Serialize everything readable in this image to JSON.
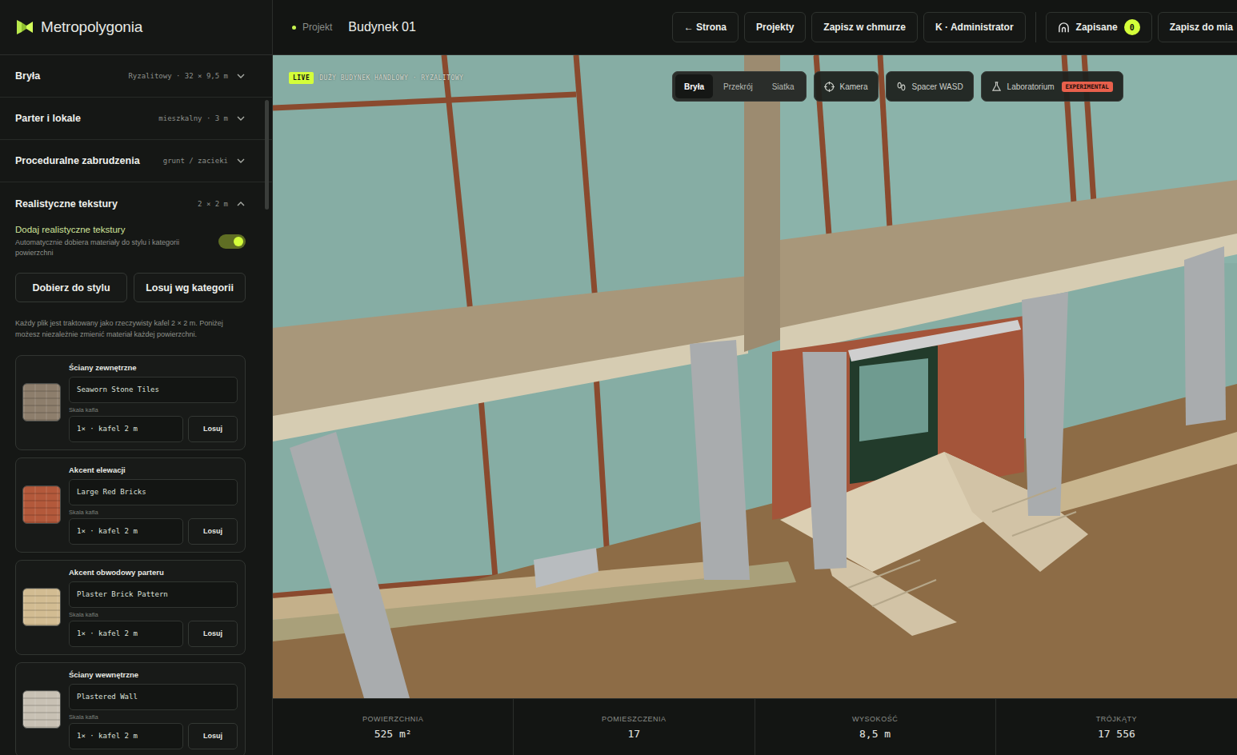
{
  "app": {
    "name": "Metropolygonia"
  },
  "header": {
    "project_label": "Projekt",
    "project_name": "Budynek 01",
    "buttons": [
      "← Strona",
      "Projekty",
      "Zapisz w chmurze",
      "K · Administrator"
    ],
    "saved": {
      "label": "Zapisane",
      "count": "0"
    },
    "cut_button": "Zapisz do mia"
  },
  "sidebar": {
    "sections": [
      {
        "title": "Bryła",
        "meta": "Ryzalitowy · 32 × 9,5 m",
        "expanded": false
      },
      {
        "title": "Parter i lokale",
        "meta": "mieszkalny · 3 m",
        "expanded": false
      },
      {
        "title": "Proceduralne zabrudzenia",
        "meta": "grunt / zacieki",
        "expanded": false
      },
      {
        "title": "Realistyczne tekstury",
        "meta": "2 × 2 m",
        "expanded": true
      }
    ],
    "textures": {
      "toggle": {
        "label": "Dodaj realistyczne tekstury",
        "description": "Automatycznie dobiera materiały do stylu i kategorii powierzchni",
        "on": true
      },
      "actions": [
        "Dobierz do stylu",
        "Losuj wg kategorii"
      ],
      "note": "Każdy plik jest traktowany jako rzeczywisty kafel 2 × 2 m. Poniżej możesz niezależnie zmienić materiał każdej powierzchni.",
      "surfaces": [
        {
          "title": "Ściany zewnętrzne",
          "material": "Seaworn Stone Tiles",
          "scale_label": "Skala kafla",
          "scale": "1× · kafel 2 m",
          "button": "Losuj",
          "color": "#8d7e6c"
        },
        {
          "title": "Akcent elewacji",
          "material": "Large Red Bricks",
          "scale_label": "Skala kafla",
          "scale": "1× · kafel 2 m",
          "button": "Losuj",
          "color": "#b3593b"
        },
        {
          "title": "Akcent obwodowy parteru",
          "material": "Plaster Brick Pattern",
          "scale_label": "Skala kafla",
          "scale": "1× · kafel 2 m",
          "button": "Losuj",
          "color": "#d2bc92"
        },
        {
          "title": "Ściany wewnętrzne",
          "material": "Plastered Wall",
          "scale_label": "Skala kafla",
          "scale": "1× · kafel 2 m",
          "button": "Losuj",
          "color": "#c8c1b4"
        }
      ]
    }
  },
  "viewport": {
    "badge": "LIVE",
    "caption": "DUŻY BUDYNEK HANDLOWY · RYZALITOWY",
    "view_modes": [
      {
        "label": "Bryła",
        "selected": true
      },
      {
        "label": "Przekrój",
        "selected": false
      },
      {
        "label": "Siatka",
        "selected": false
      }
    ],
    "tools": [
      {
        "label": "Kamera"
      },
      {
        "label": "Spacer WASD"
      },
      {
        "label": "Laboratorium",
        "badge": "EXPERIMENTAL"
      }
    ]
  },
  "stats": [
    {
      "label": "POWIERZCHNIA",
      "value": "525 m²"
    },
    {
      "label": "POMIESZCZENIA",
      "value": "17"
    },
    {
      "label": "WYSOKOŚĆ",
      "value": "8,5 m"
    },
    {
      "label": "TRÓJKĄTY",
      "value": "17 556"
    }
  ]
}
